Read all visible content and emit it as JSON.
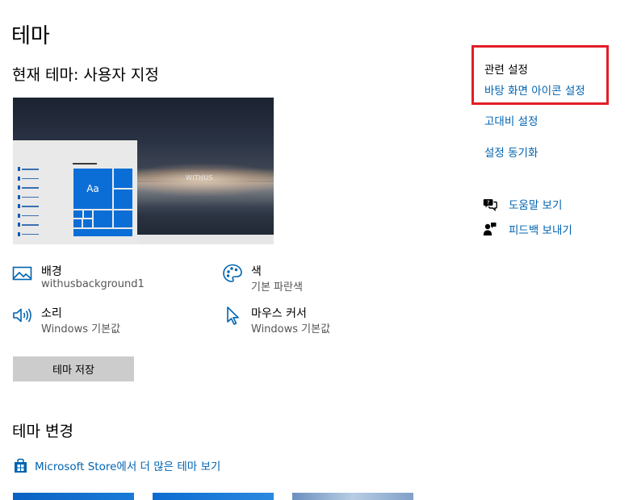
{
  "page": {
    "title": "테마"
  },
  "current_theme": {
    "title": "현재 테마: 사용자 지정"
  },
  "preview": {
    "tile_label": "Aa",
    "watermark": "WITHUS"
  },
  "settings": {
    "background": {
      "name": "배경",
      "value": "withusbackground1",
      "icon": "picture-icon"
    },
    "color": {
      "name": "색",
      "value": "기본 파란색",
      "icon": "palette-icon"
    },
    "sound": {
      "name": "소리",
      "value": "Windows 기본값",
      "icon": "speaker-icon"
    },
    "cursor": {
      "name": "마우스 커서",
      "value": "Windows 기본값",
      "icon": "pointer-icon"
    }
  },
  "save_button": {
    "label": "테마 저장"
  },
  "change_theme": {
    "title": "테마 변경",
    "store_link": "Microsoft Store에서 더 많은 테마 보기",
    "store_icon": "store-bag-icon"
  },
  "related_settings": {
    "title": "관련 설정",
    "links": [
      "바탕 화면 아이콘 설정",
      "고대비 설정",
      "설정 동기화"
    ]
  },
  "help": [
    {
      "label": "도움말 보기",
      "icon": "help-chat-icon"
    },
    {
      "label": "피드백 보내기",
      "icon": "feedback-person-icon"
    }
  ],
  "colors": {
    "link": "#0063b1",
    "accent": "#0b6ed6",
    "highlight_border": "#e31d26",
    "button_bg": "#cccccc"
  }
}
